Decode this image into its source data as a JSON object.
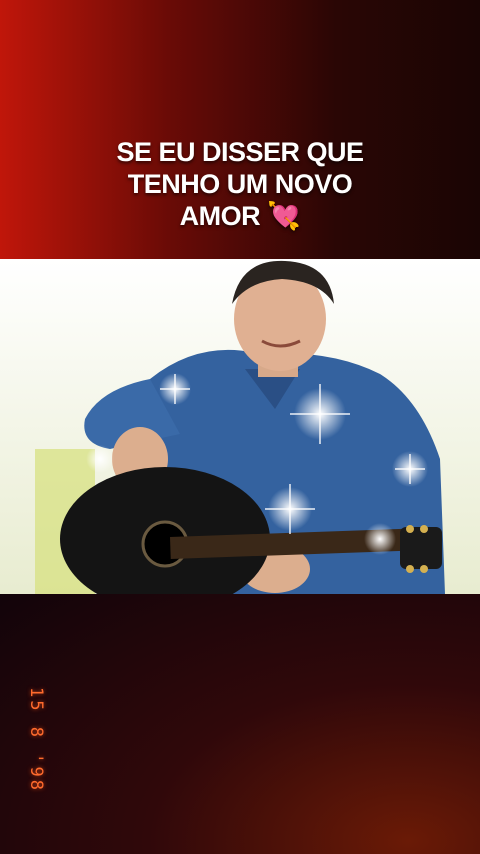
{
  "caption": {
    "line1": "SE EU DISSER QUE",
    "line2": "TENHO UM NOVO",
    "line3": "AMOR",
    "emoji": "💘"
  },
  "date_stamp": "15 8 '98",
  "photo": {
    "subject": "man-with-guitar",
    "colors": {
      "denim": "#2e5a9c",
      "guitar": "#141414",
      "background": "#ffffff",
      "grass": "#c8d86a"
    }
  }
}
